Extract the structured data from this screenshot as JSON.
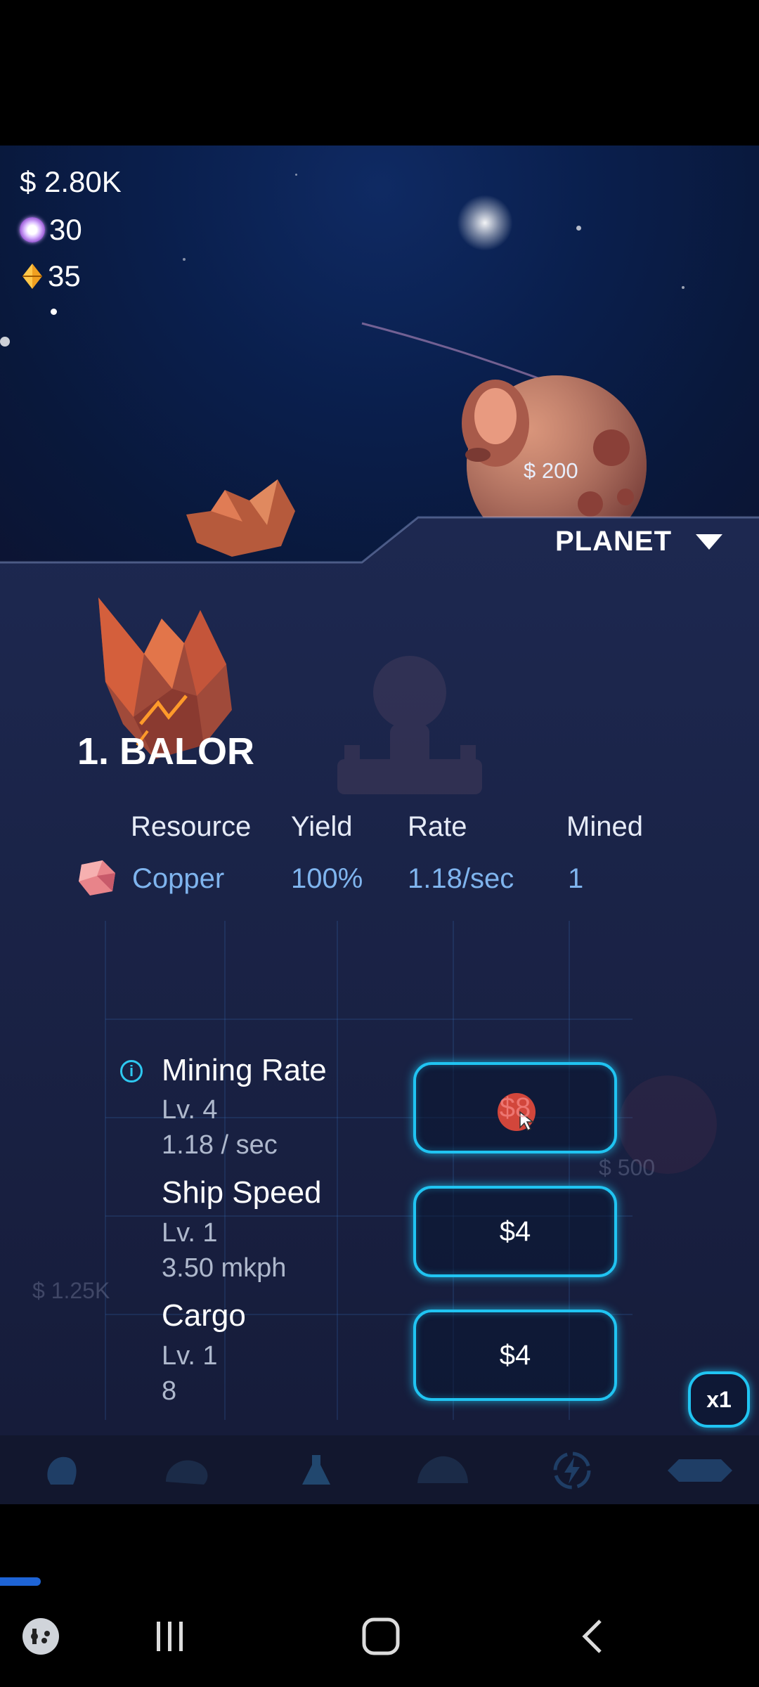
{
  "hud": {
    "cash": "$ 2.80K",
    "orbs": "30",
    "crystals": "35"
  },
  "next_planet": {
    "price": "$ 200"
  },
  "panel": {
    "tab_label": "PLANET",
    "planet_title": "1. BALOR",
    "table": {
      "headers": [
        "Resource",
        "Yield",
        "Rate",
        "Mined"
      ],
      "rows": [
        {
          "resource": "Copper",
          "yield": "100%",
          "rate": "1.18/sec",
          "mined": "1"
        }
      ]
    },
    "upgrades": [
      {
        "name": "Mining Rate",
        "level": "Lv. 4",
        "stat": "1.18 / sec",
        "cost": "$8"
      },
      {
        "name": "Ship Speed",
        "level": "Lv. 1",
        "stat": "3.50 mkph",
        "cost": "$4"
      },
      {
        "name": "Cargo",
        "level": "Lv. 1",
        "stat": "8",
        "cost": "$4"
      }
    ],
    "background_prices": [
      "$ 500",
      "$ 1.25K"
    ],
    "multiplier": "x1"
  },
  "nav_icons": [
    "planet-icon",
    "moon-icon",
    "flask-icon",
    "dome-icon",
    "lightning-icon",
    "mothership-icon"
  ],
  "colors": {
    "accent": "#20c4f2",
    "resource_text": "#7fb4ee",
    "panel_bg": "#1b2448",
    "space_bg": "#0a1f4d"
  }
}
